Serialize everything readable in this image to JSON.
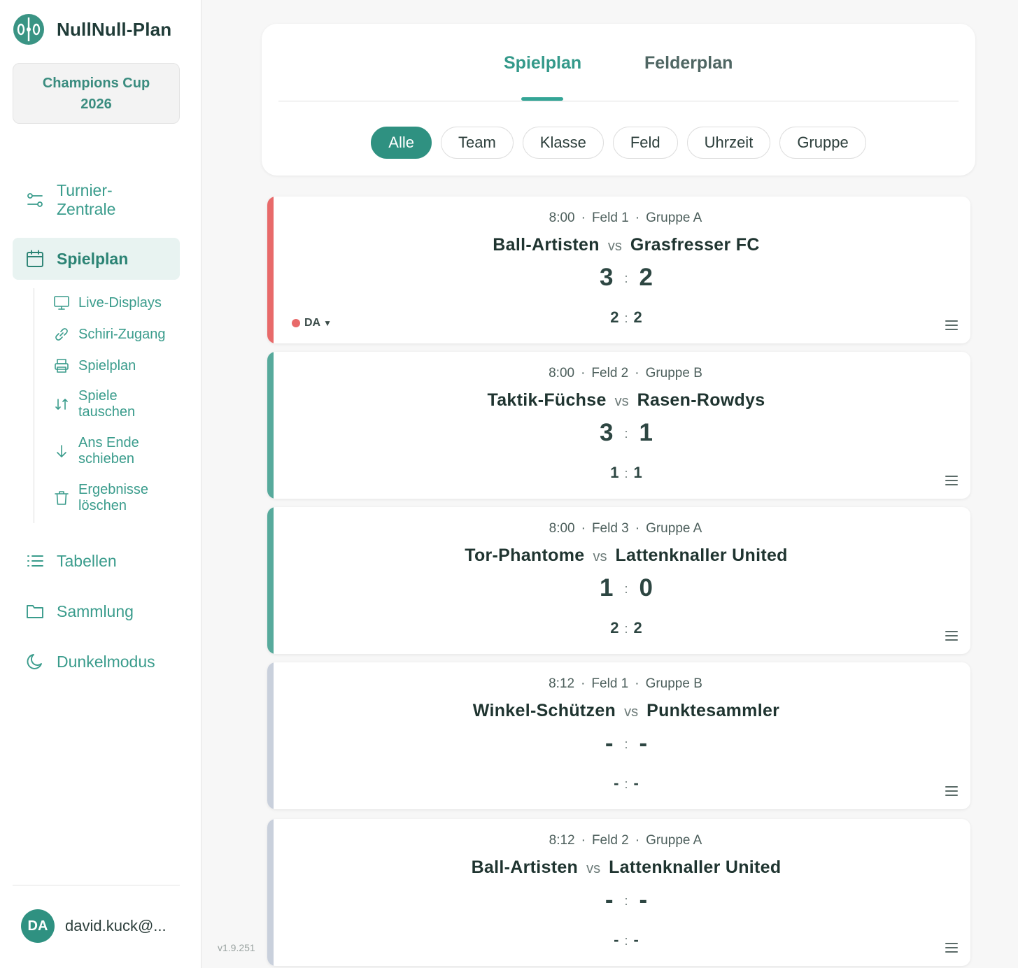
{
  "app": {
    "name": "NullNull-Plan"
  },
  "tournament": {
    "name": "Champions Cup 2026"
  },
  "nav": {
    "turnier_zentrale": "Turnier-\nZentrale",
    "spielplan": "Spielplan",
    "tabellen": "Tabellen",
    "sammlung": "Sammlung",
    "dunkelmodus": "Dunkelmodus"
  },
  "subnav": {
    "live_displays": "Live-Displays",
    "schiri_zugang": "Schiri-Zugang",
    "spielplan_print": "Spielplan",
    "spiele_tauschen": "Spiele\ntauschen",
    "ans_ende": "Ans Ende\nschieben",
    "ergebnisse_loeschen": "Ergebnisse\nlöschen"
  },
  "user": {
    "initials": "DA",
    "email": "david.kuck@..."
  },
  "version": "v1.9.251",
  "tabs": {
    "spielplan": "Spielplan",
    "felderplan": "Felderplan"
  },
  "filters": [
    "Alle",
    "Team",
    "Klasse",
    "Feld",
    "Uhrzeit",
    "Gruppe"
  ],
  "colors": {
    "accent": "#2f9181",
    "live": "#e86a6a",
    "finished": "#57aa9c",
    "pending": "#c9d0dc"
  },
  "matches": [
    {
      "time": "8:00",
      "field": "Feld 1",
      "group": "Gruppe A",
      "home": "Ball-Artisten",
      "vs": "vs",
      "away": "Grasfresser FC",
      "score_home": "3",
      "score_away": "2",
      "half_home": "2",
      "half_away": "2",
      "status": "live",
      "referee": "DA"
    },
    {
      "time": "8:00",
      "field": "Feld 2",
      "group": "Gruppe B",
      "home": "Taktik-Füchse",
      "vs": "vs",
      "away": "Rasen-Rowdys",
      "score_home": "3",
      "score_away": "1",
      "half_home": "1",
      "half_away": "1",
      "status": "finished"
    },
    {
      "time": "8:00",
      "field": "Feld 3",
      "group": "Gruppe A",
      "home": "Tor-Phantome",
      "vs": "vs",
      "away": "Lattenknaller United",
      "score_home": "1",
      "score_away": "0",
      "half_home": "2",
      "half_away": "2",
      "status": "finished"
    },
    {
      "time": "8:12",
      "field": "Feld 1",
      "group": "Gruppe B",
      "home": "Winkel-Schützen",
      "vs": "vs",
      "away": "Punktesammler",
      "score_home": "-",
      "score_away": "-",
      "half_home": "-",
      "half_away": "-",
      "status": "pending"
    },
    {
      "time": "8:12",
      "field": "Feld 2",
      "group": "Gruppe A",
      "home": "Ball-Artisten",
      "vs": "vs",
      "away": "Lattenknaller United",
      "score_home": "-",
      "score_away": "-",
      "half_home": "-",
      "half_away": "-",
      "status": "pending"
    }
  ]
}
